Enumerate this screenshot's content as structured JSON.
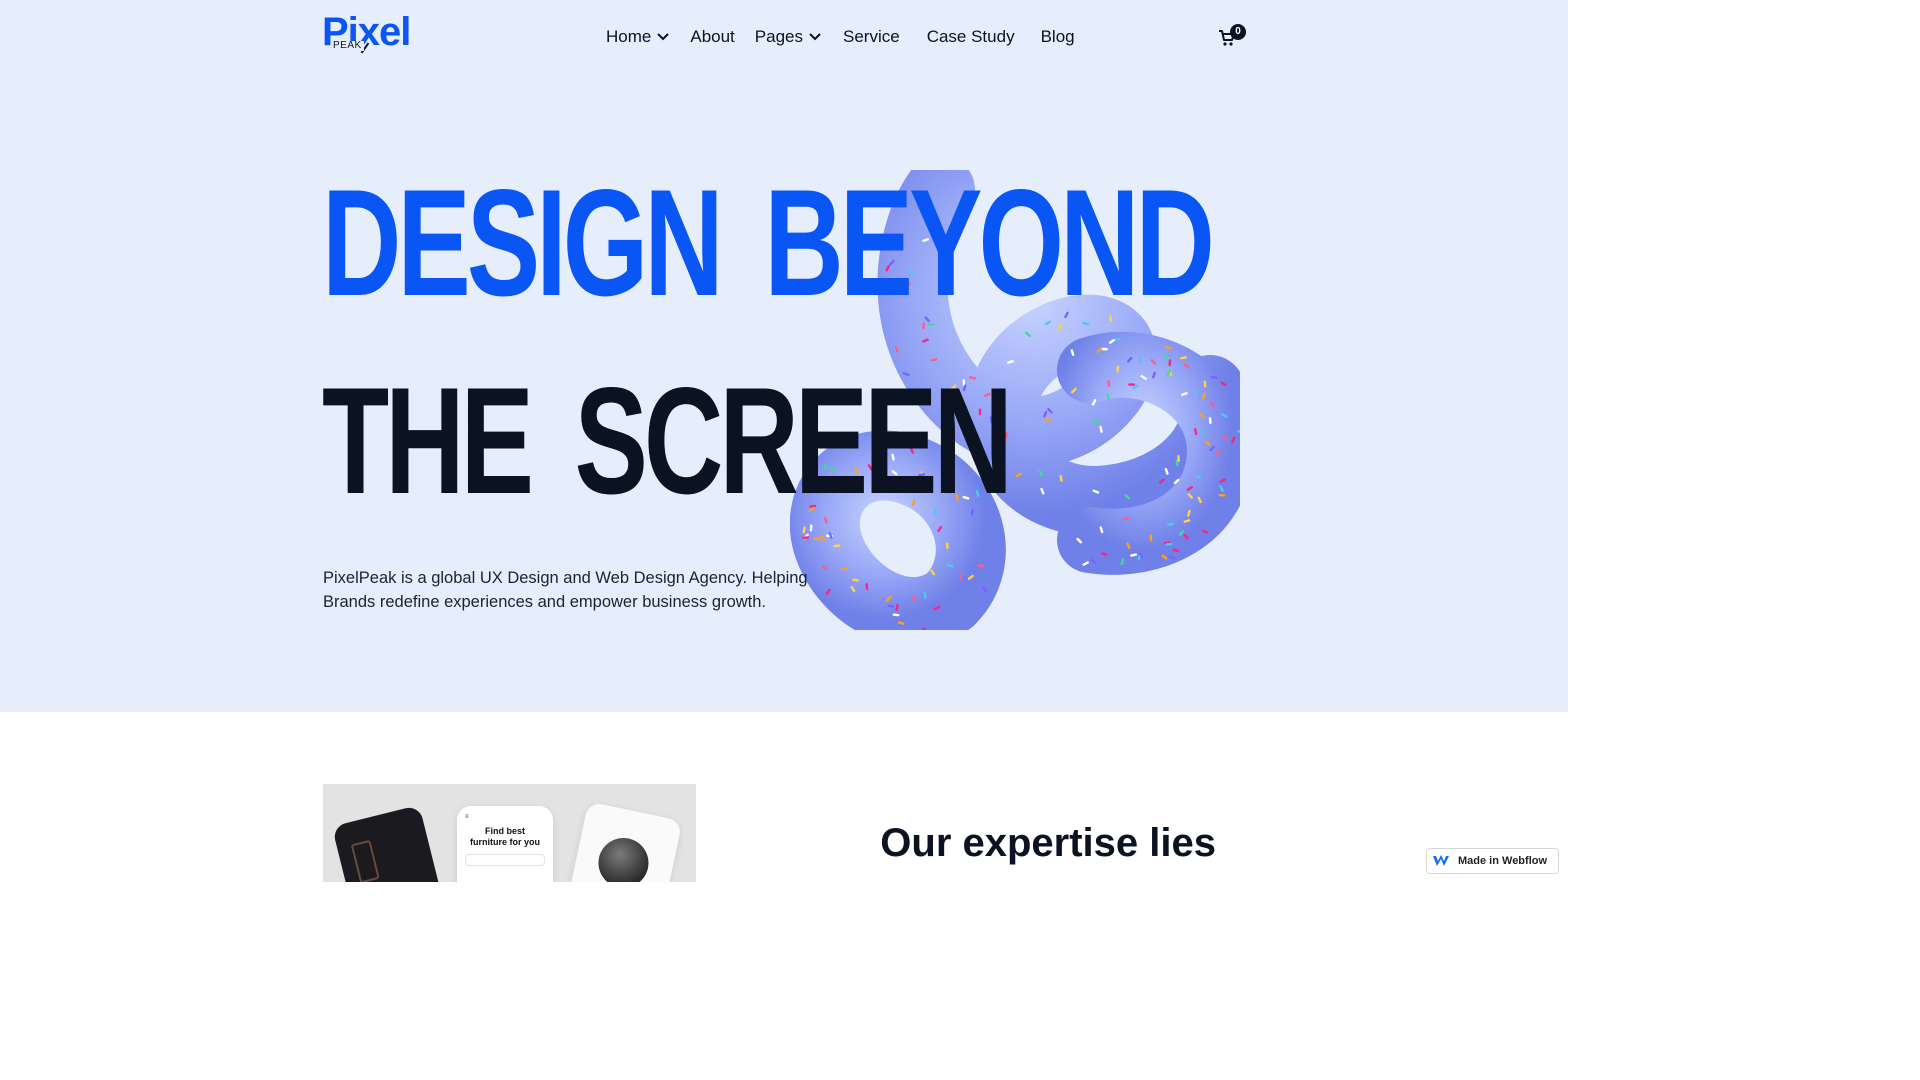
{
  "brand": {
    "logo_word": "Pixel",
    "logo_sub": "PEAK",
    "accent_color": "#0a56f4",
    "dark_color": "#0b1222",
    "hero_bg": "#e6eefc"
  },
  "nav": {
    "items": [
      {
        "label": "Home",
        "has_dropdown": true
      },
      {
        "label": "About",
        "has_dropdown": false
      },
      {
        "label": "Pages",
        "has_dropdown": true
      },
      {
        "label": "Service",
        "has_dropdown": false
      },
      {
        "label": "Case Study",
        "has_dropdown": false
      },
      {
        "label": "Blog",
        "has_dropdown": false
      }
    ],
    "cart_count": "0",
    "cart_icon": "cart-icon"
  },
  "hero": {
    "headline_line1": "Design Beyond",
    "headline_line2": "The Screen",
    "description": "PixelPeak is a global UX Design and Web Design Agency. Helping Brands redefine experiences and empower business growth.",
    "decoration": "sprinkled-donut-knot"
  },
  "section2": {
    "preview_title": "Find best furniture for you",
    "heading": "Our expertise lies"
  },
  "badge": {
    "label": "Made in Webflow",
    "icon": "webflow-icon"
  }
}
